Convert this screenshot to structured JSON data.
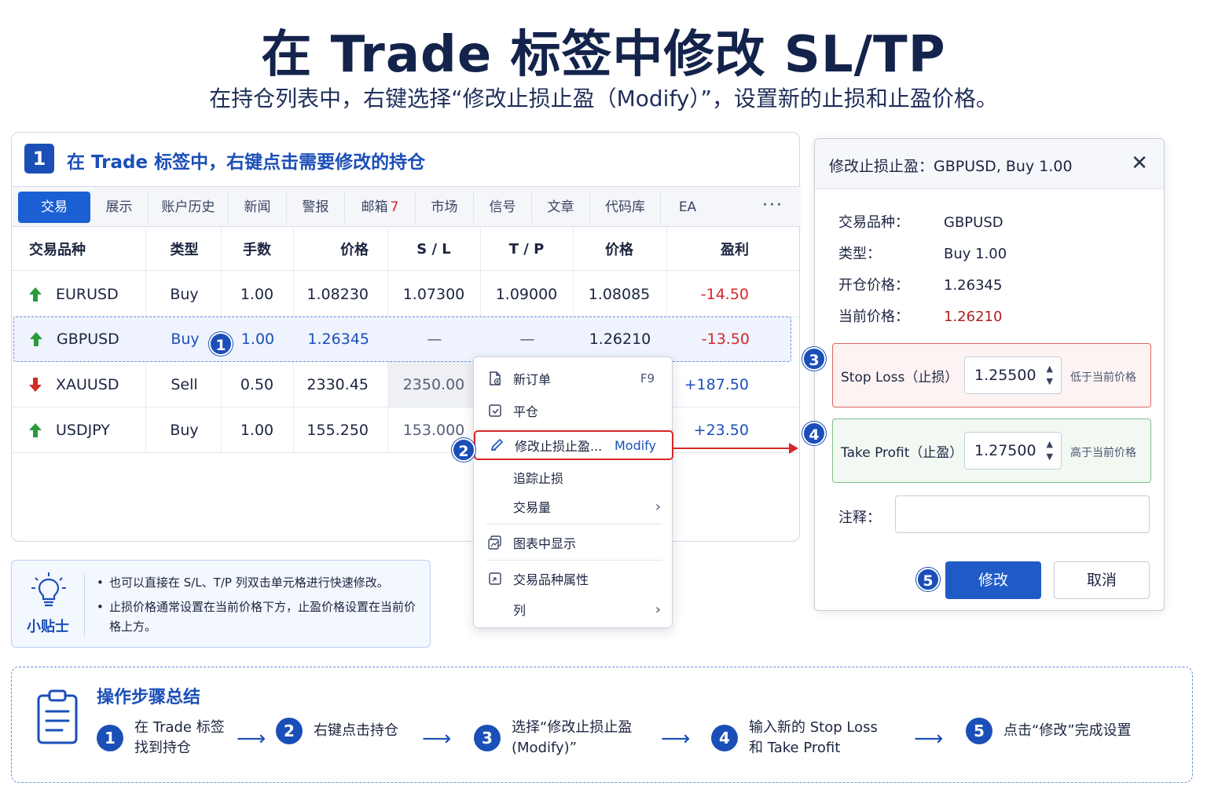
{
  "title": "在 Trade 标签中修改 SL/TP",
  "subtitle": "在持仓列表中，右键选择“修改止损止盈（Modify）”，设置新的止损和止盈价格。",
  "panel": {
    "step": "1",
    "heading": "在 Trade 标签中，右键点击需要修改的持仓"
  },
  "tabs": [
    {
      "label": "交易",
      "badge": ""
    },
    {
      "label": "展示",
      "badge": ""
    },
    {
      "label": "账户历史",
      "badge": ""
    },
    {
      "label": "新闻",
      "badge": ""
    },
    {
      "label": "警报",
      "badge": ""
    },
    {
      "label": "邮箱",
      "badge": "7"
    },
    {
      "label": "市场",
      "badge": ""
    },
    {
      "label": "信号",
      "badge": ""
    },
    {
      "label": "文章",
      "badge": ""
    },
    {
      "label": "代码库",
      "badge": ""
    },
    {
      "label": "EA",
      "badge": ""
    }
  ],
  "tab_more": "···",
  "columns": {
    "symbol": "交易品种",
    "type": "类型",
    "lots": "手数",
    "price": "价格",
    "sl": "S / L",
    "tp": "T / P",
    "current": "价格",
    "profit": "盈利"
  },
  "rows": [
    {
      "symbol": "EURUSD",
      "direction": "up",
      "type": "Buy",
      "lots": "1.00",
      "price": "1.08230",
      "sl": "1.07300",
      "tp": "1.09000",
      "current": "1.08085",
      "profit": "-14.50"
    },
    {
      "symbol": "GBPUSD",
      "direction": "up",
      "type": "Buy",
      "lots": "1.00",
      "price": "1.26345",
      "sl": "—",
      "tp": "—",
      "current": "1.26210",
      "profit": "-13.50"
    },
    {
      "symbol": "XAUUSD",
      "direction": "down",
      "type": "Sell",
      "lots": "0.50",
      "price": "2330.45",
      "sl": "2350.00",
      "tp": "",
      "current": "",
      "profit": "+187.50"
    },
    {
      "symbol": "USDJPY",
      "direction": "up",
      "type": "Buy",
      "lots": "1.00",
      "price": "155.250",
      "sl": "153.000",
      "tp": "",
      "current": "",
      "profit": "+23.50"
    }
  ],
  "markers": {
    "one": "1",
    "two": "2",
    "three": "3",
    "four": "4",
    "five": "5"
  },
  "context_menu": {
    "new_order": "新订单",
    "new_order_shortcut": "F9",
    "close": "平仓",
    "modify": "修改止损止盈...",
    "modify_en": "Modify",
    "trailing": "追踪止损",
    "volume": "交易量",
    "show_chart": "图表中显示",
    "symbol_props": "交易品种属性",
    "columns": "列"
  },
  "tip": {
    "label": "小贴士",
    "items": [
      "也可以直接在 S/L、T/P 列双击单元格进行快速修改。",
      "止损价格通常设置在当前价格下方，止盈价格设置在当前价格上方。"
    ]
  },
  "dialog": {
    "title": "修改止损止盈：GBPUSD, Buy 1.00",
    "close": "✕",
    "symbol_label": "交易品种：",
    "symbol_value": "GBPUSD",
    "type_label": "类型：",
    "type_value": "Buy 1.00",
    "open_label": "开仓价格：",
    "open_value": "1.26345",
    "current_label": "当前价格：",
    "current_value": "1.26210",
    "sl_label": "Stop Loss（止损）",
    "sl_value": "1.25500",
    "sl_hint": "低于当前价格",
    "tp_label": "Take Profit（止盈）",
    "tp_value": "1.27500",
    "tp_hint": "高于当前价格",
    "comment_label": "注释：",
    "comment_value": "",
    "ok": "修改",
    "cancel": "取消"
  },
  "summary": {
    "title": "操作步骤总结",
    "steps": [
      {
        "num": "1",
        "line1": "在 Trade 标签",
        "line2": "找到持仓"
      },
      {
        "num": "2",
        "line1": "右键点击持仓",
        "line2": ""
      },
      {
        "num": "3",
        "line1": "选择“修改止损止盈",
        "line2": "(Modify)”"
      },
      {
        "num": "4",
        "line1": "输入新的 Stop Loss",
        "line2": "和 Take Profit"
      },
      {
        "num": "5",
        "line1": "点击“修改”完成设置",
        "line2": ""
      }
    ]
  },
  "colors": {
    "accent": "#1b4fb8",
    "title": "#14234b",
    "loss": "#d62828",
    "gain": "#1b4fb8",
    "up_arrow": "#2a9a3c",
    "down_arrow": "#d62828"
  }
}
